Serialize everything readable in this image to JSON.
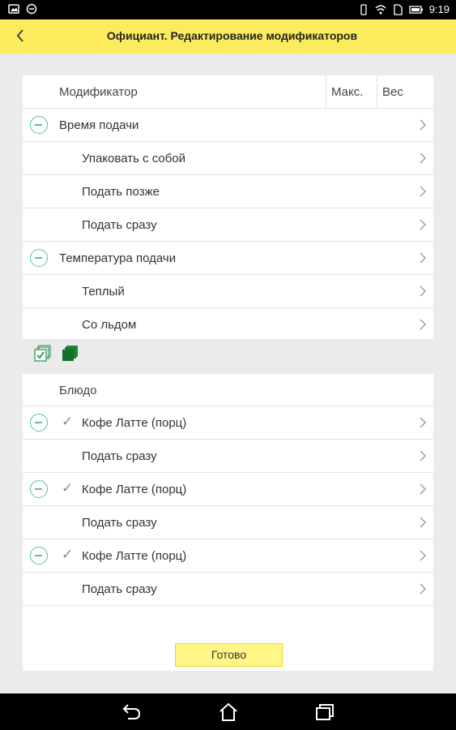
{
  "statusbar": {
    "time": "9:19"
  },
  "header": {
    "title": "Официант.  Редактирование модификаторов"
  },
  "modifiers": {
    "col_modifier": "Модификатор",
    "col_max": "Макс.",
    "col_weight": "Вес",
    "rows": [
      {
        "label": "Время подачи",
        "level": 1,
        "removable": true
      },
      {
        "label": "Упаковать с собой",
        "level": 2,
        "removable": false
      },
      {
        "label": "Подать позже",
        "level": 2,
        "removable": false
      },
      {
        "label": "Подать сразу",
        "level": 2,
        "removable": false
      },
      {
        "label": "Температура подачи",
        "level": 1,
        "removable": true
      },
      {
        "label": "Теплый",
        "level": 2,
        "removable": false
      },
      {
        "label": "Со льдом",
        "level": 2,
        "removable": false
      }
    ]
  },
  "toolbar": {
    "select_all_icon": "select-all-icon",
    "copy_icon": "copy-icon"
  },
  "dishes": {
    "col_dish": "Блюдо",
    "rows": [
      {
        "label": "Кофе Латте (порц)",
        "checked": true
      },
      {
        "label": "Подать сразу",
        "checked": false
      },
      {
        "label": "Кофе Латте (порц)",
        "checked": true
      },
      {
        "label": "Подать сразу",
        "checked": false
      },
      {
        "label": "Кофе Латте (порц)",
        "checked": true
      },
      {
        "label": "Подать сразу",
        "checked": false
      }
    ]
  },
  "done_button": "Готово",
  "colors": {
    "header_bg": "#fdeb5e",
    "accent_green": "#5dbf9b",
    "button_bg": "#fff685"
  }
}
